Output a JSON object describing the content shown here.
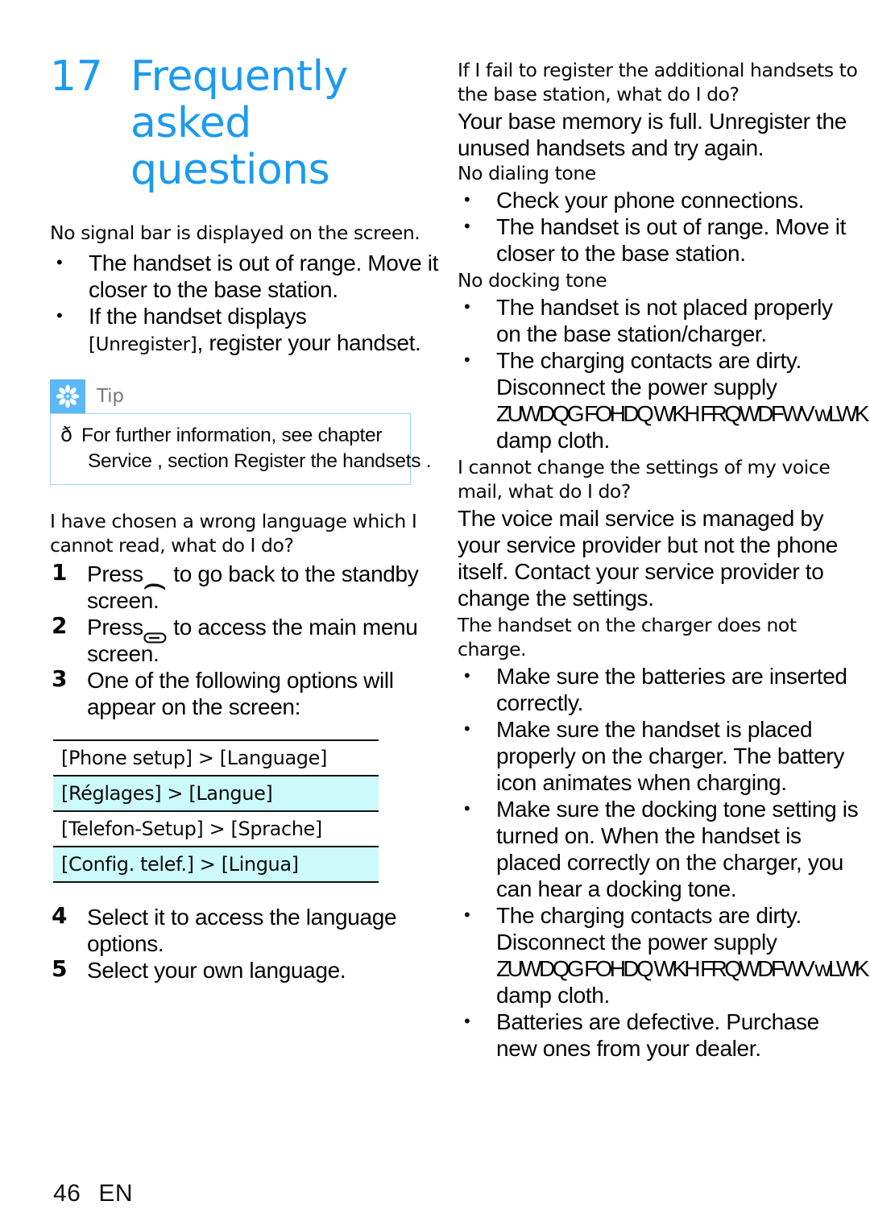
{
  "chapter": {
    "number": "17",
    "title_lines": [
      "Frequently",
      "asked",
      "questions"
    ],
    "accent_color": "#1C9AF0"
  },
  "left_column": {
    "q1": "No signal bar is displayed on the screen.",
    "q1_bullets": [
      "The handset is out of range. Move it closer to the base station.",
      "If the handset displays [Unregister], register your handset."
    ],
    "q1_bullet2_prefix": "If the handset displays",
    "q1_bullet2_bracket": "[Unregister]",
    "q1_bullet2_suffix": ", register your handset.",
    "tip": {
      "label": "Tip",
      "icon": "asterisk-flower-icon",
      "bullet_char": "ð",
      "line1": "For further information, see chapter",
      "line2": "Service , section  Register the handsets ."
    },
    "q2": "I have chosen a wrong language which I cannot read, what do I do?",
    "steps": [
      {
        "num": "1",
        "text_before": "Press",
        "glyph": "end-call-key-icon",
        "text_after": "to go back to the standby screen."
      },
      {
        "num": "2",
        "text_before": "Press",
        "glyph": "soft-key-icon",
        "text_after": "to access the main menu screen."
      },
      {
        "num": "3",
        "text_before": "",
        "glyph": "",
        "text_after": "One of the following options will appear on the screen:"
      }
    ],
    "lang_table": {
      "rows": [
        "[Phone setup] > [Language]",
        "[Réglages] > [Langue]",
        "[Telefon-Setup] > [Sprache]",
        "[Config. telef.] > [Lingua]"
      ],
      "alt_row_color": "#CCFAFA"
    },
    "steps_tail": [
      {
        "num": "4",
        "text": "Select it to access the language options."
      },
      {
        "num": "5",
        "text": "Select your own language."
      }
    ]
  },
  "right_column": {
    "q1": "If I fail to register the additional handsets to the base station, what do I do?",
    "a1": "Your base memory is full. Unregister the unused handsets and try again.",
    "q2": "No dialing tone",
    "q2_bullets": [
      "Check your phone connections.",
      "The handset is out of range. Move it closer to the base station."
    ],
    "q3": "No docking tone",
    "q3_bullets": [
      "The handset is not placed properly on the base station/charger.",
      "The charging contacts are dirty. Disconnect the power supply"
    ],
    "garbled_line": "ZUWDQG FOHDQ WKH FRQWDFWV wLWK D",
    "garbled_tail": "damp cloth.",
    "q4": "I cannot change the settings of my voice mail, what do I do?",
    "a4": "The voice mail service is managed by your service provider but not the phone itself. Contact your service provider to change the settings.",
    "q5": "The handset on the charger does not charge.",
    "q5_bullets": [
      "Make sure the batteries are inserted correctly.",
      "Make sure the handset is placed properly on the charger. The battery icon animates when charging.",
      "Make sure the docking tone setting is turned on. When the handset is placed correctly on the charger, you can hear a docking tone.",
      "The charging contacts are dirty. Disconnect the power supply",
      "Batteries are defective. Purchase new ones from your dealer."
    ]
  },
  "footer": {
    "page_number": "46",
    "language_code": "EN"
  }
}
